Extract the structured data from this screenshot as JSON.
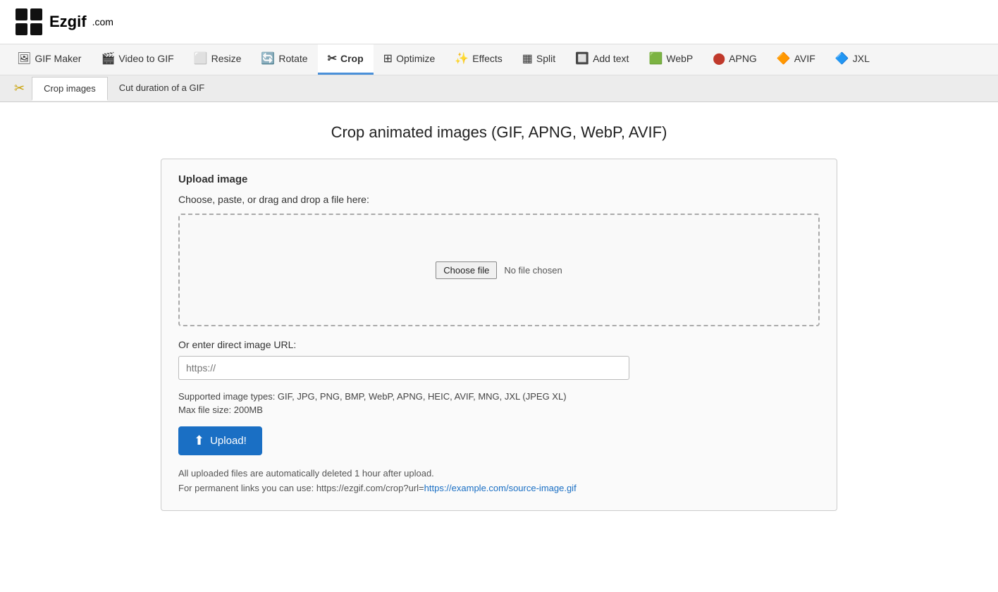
{
  "logo": {
    "text": "Ezgif",
    "suffix": ".com"
  },
  "nav": {
    "items": [
      {
        "id": "gif-maker",
        "icon": "🖼",
        "label": "GIF Maker",
        "active": false
      },
      {
        "id": "video-to-gif",
        "icon": "🎬",
        "label": "Video to GIF",
        "active": false
      },
      {
        "id": "resize",
        "icon": "⬜",
        "label": "Resize",
        "active": false
      },
      {
        "id": "rotate",
        "icon": "🔄",
        "label": "Rotate",
        "active": false
      },
      {
        "id": "crop",
        "icon": "✂",
        "label": "Crop",
        "active": true
      },
      {
        "id": "optimize",
        "icon": "⊞",
        "label": "Optimize",
        "active": false
      },
      {
        "id": "effects",
        "icon": "✨",
        "label": "Effects",
        "active": false
      },
      {
        "id": "split",
        "icon": "▦",
        "label": "Split",
        "active": false
      },
      {
        "id": "add-text",
        "icon": "🔲",
        "label": "Add text",
        "active": false
      },
      {
        "id": "webp",
        "icon": "🟩",
        "label": "WebP",
        "active": false
      },
      {
        "id": "apng",
        "icon": "🔴",
        "label": "APNG",
        "active": false
      },
      {
        "id": "avif",
        "icon": "🔶",
        "label": "AVIF",
        "active": false
      },
      {
        "id": "jxl",
        "icon": "🔷",
        "label": "JXL",
        "active": false
      }
    ]
  },
  "sub_nav": {
    "scissors_icon": "✂",
    "tabs": [
      {
        "id": "crop-images",
        "label": "Crop images",
        "active": true
      },
      {
        "id": "cut-duration",
        "label": "Cut duration of a GIF",
        "active": false
      }
    ]
  },
  "main": {
    "page_title": "Crop animated images (GIF, APNG, WebP, AVIF)",
    "upload_card": {
      "title": "Upload image",
      "description": "Choose, paste, or drag and drop a file here:",
      "choose_file_label": "Choose file",
      "no_file_text": "No file chosen",
      "url_label": "Or enter direct image URL:",
      "url_placeholder": "https://",
      "supported_types": "Supported image types: GIF, JPG, PNG, BMP, WebP, APNG, HEIC, AVIF, MNG, JXL (JPEG XL)",
      "max_file_size": "Max file size: 200MB",
      "upload_button_label": "Upload!",
      "upload_icon": "⬆",
      "footer_note_line1": "All uploaded files are automatically deleted 1 hour after upload.",
      "footer_note_line2_prefix": "For permanent links you can use: https://ezgif.com/crop?url=",
      "footer_note_link": "https://example.com/source-image.gif"
    }
  }
}
